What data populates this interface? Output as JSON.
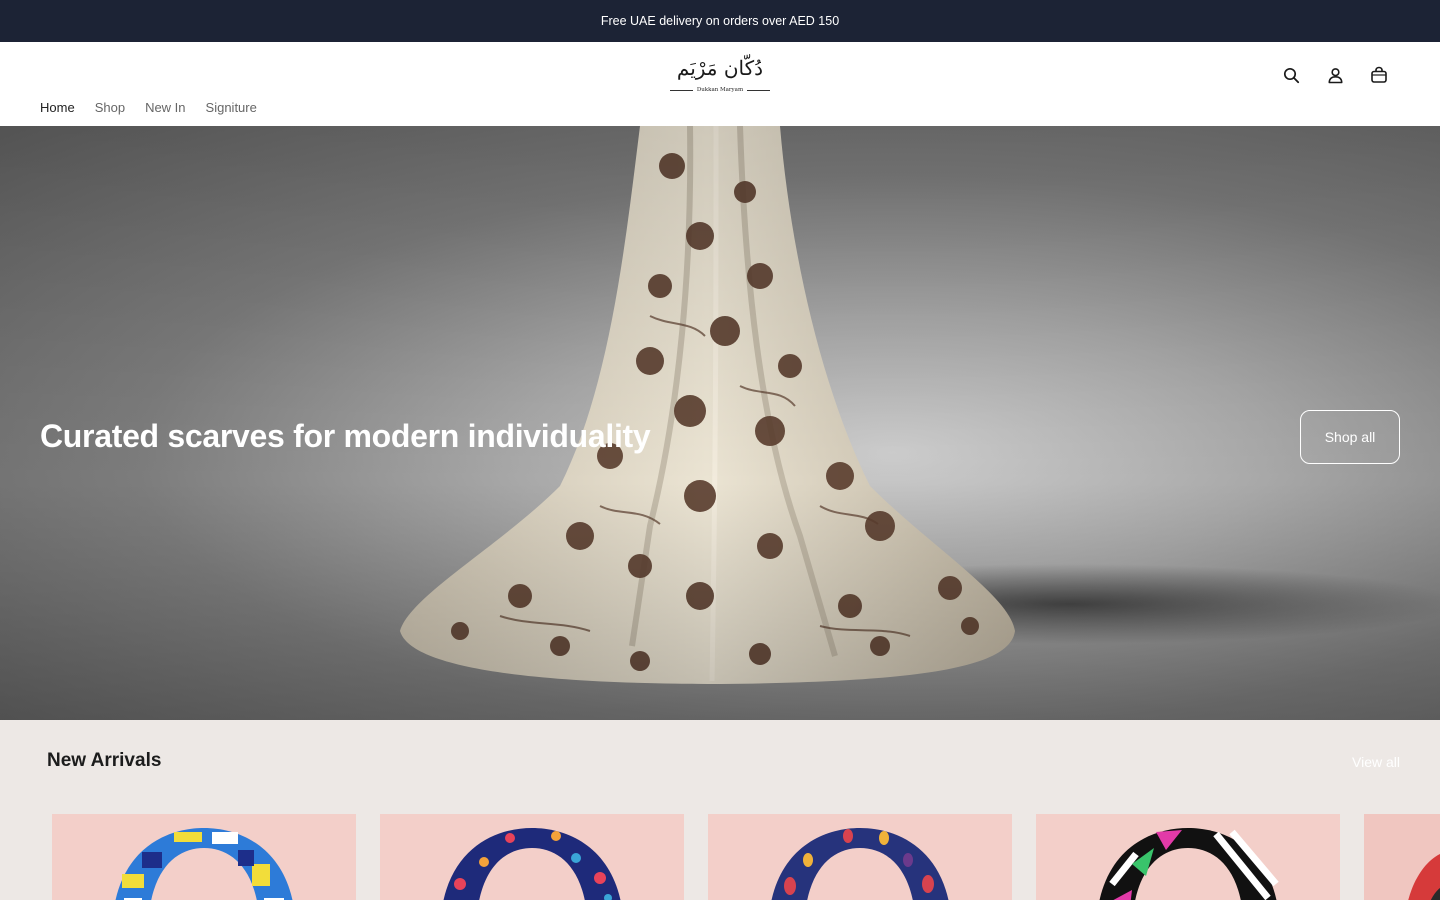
{
  "announcement": {
    "text": "Free UAE delivery on orders over AED 150"
  },
  "logo": {
    "arabic": "دُكّان مَرْيَم",
    "english": "Dukkan Maryam"
  },
  "header_icons": [
    "search-icon",
    "account-icon",
    "cart-icon"
  ],
  "nav": {
    "items": [
      {
        "label": "Home",
        "active": true
      },
      {
        "label": "Shop",
        "active": false
      },
      {
        "label": "New In",
        "active": false
      },
      {
        "label": "Signiture",
        "active": false
      }
    ]
  },
  "hero": {
    "title": "Curated scarves for modern individuality",
    "button": "Shop all"
  },
  "new_arrivals": {
    "title": "New Arrivals",
    "view_all": "View all",
    "products": [
      {
        "palette": [
          "#2d7bd8",
          "#f2dd3a",
          "#ffffff",
          "#1d2e8a"
        ]
      },
      {
        "palette": [
          "#1e2a7a",
          "#e8435a",
          "#f4a23a",
          "#3aa6d8"
        ]
      },
      {
        "palette": [
          "#26337c",
          "#d8434f",
          "#f0b23a",
          "#6b3a8c"
        ]
      },
      {
        "palette": [
          "#111111",
          "#ffffff",
          "#e23aa8",
          "#39c46b"
        ]
      },
      {
        "palette": [
          "#d63a3a",
          "#f0c6c0",
          "#2a2a2a",
          "#e85a7a"
        ]
      }
    ]
  },
  "colors": {
    "announcement_bg": "#1c2335",
    "page_bg": "#ede8e5",
    "accent_text": "#ffffff"
  }
}
